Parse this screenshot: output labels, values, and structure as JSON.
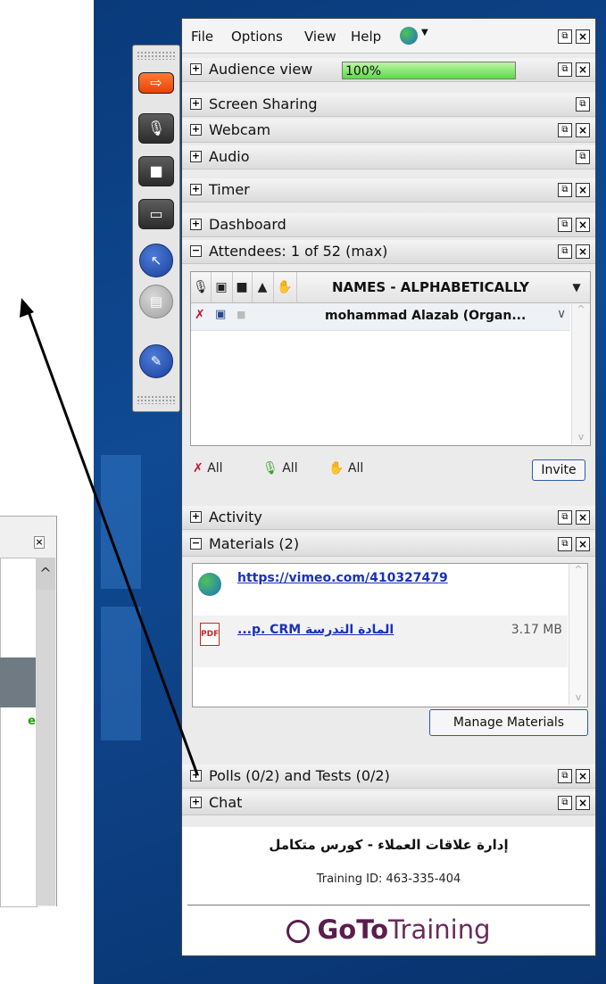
{
  "menubar": {
    "items": [
      "File",
      "Options",
      "View",
      "Help"
    ]
  },
  "audience": {
    "label": "Audience view",
    "progress_text": "100%",
    "progress": 100
  },
  "sections": {
    "screen_sharing": "Screen Sharing",
    "webcam": "Webcam",
    "audio": "Audio",
    "timer": "Timer",
    "dashboard": "Dashboard",
    "attendees": "Attendees: 1 of 52 (max)",
    "activity": "Activity",
    "materials": "Materials (2)",
    "polls": "Polls (0/2) and Tests (0/2)",
    "chat": "Chat"
  },
  "attendees": {
    "header_name": "NAMES - ALPHABETICALLY",
    "rows": [
      {
        "name": "mohammad Alazab (Organ..."
      }
    ],
    "all_label": "All",
    "invite_label": "Invite"
  },
  "materials": {
    "items": [
      {
        "text": "https://vimeo.com/410327479",
        "size": "",
        "icon": "globe-icon"
      },
      {
        "text": "...p.  CRM  المادة التدرسة",
        "size": "3.17 MB",
        "icon": "pdf-icon"
      }
    ],
    "manage_label": "Manage Materials"
  },
  "footer": {
    "title": "إدارة علاقات العملاء - كورس متكامل",
    "training_id": "Training ID: 463-335-404",
    "brand_bold": "GoTo",
    "brand_light": "Training"
  },
  "colors": {
    "desktop": "#0f4a93",
    "progress": "#5fd94a",
    "link": "#1a31b8",
    "brand": "#5a1d4d",
    "orange_button": "#e8420a"
  }
}
